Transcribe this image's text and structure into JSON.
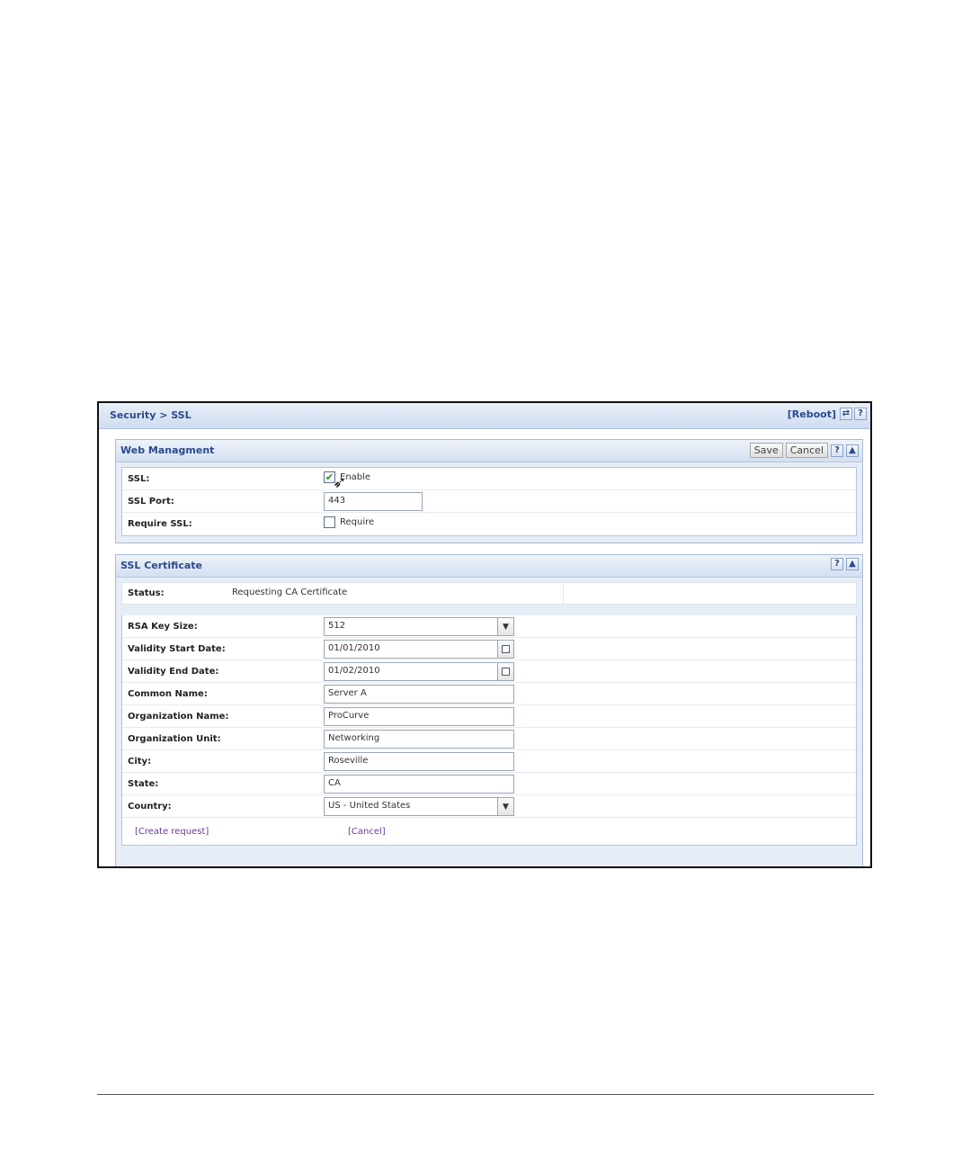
{
  "topbar": {
    "breadcrumb": "Security > SSL",
    "reboot_label": "[Reboot]",
    "refresh_glyph": "⇄",
    "help_glyph": "?"
  },
  "web_management": {
    "title": "Web Managment",
    "save_label": "Save",
    "cancel_label": "Cancel",
    "help_glyph": "?",
    "collapse_glyph": "▲",
    "ssl_label": "SSL:",
    "ssl_enable_checked": true,
    "ssl_enable_label": "Enable",
    "port_label": "SSL Port:",
    "port_value": "443",
    "require_label": "Require SSL:",
    "require_checked": false,
    "require_option_label": "Require"
  },
  "ssl_certificate": {
    "title": "SSL Certificate",
    "help_glyph": "?",
    "collapse_glyph": "▲",
    "status_label": "Status:",
    "status_value": "Requesting CA Certificate",
    "fields": {
      "rsa_label": "RSA Key Size:",
      "rsa_value": "512",
      "start_label": "Validity Start Date:",
      "start_value": "01/01/2010",
      "end_label": "Validity End Date:",
      "end_value": "01/02/2010",
      "cn_label": "Common Name:",
      "cn_value": "Server A",
      "org_label": "Organization Name:",
      "org_value": "ProCurve",
      "unit_label": "Organization Unit:",
      "unit_value": "Networking",
      "city_label": "City:",
      "city_value": "Roseville",
      "state_label": "State:",
      "state_value": "CA",
      "country_label": "Country:",
      "country_value": "US - United States"
    },
    "create_link": "[Create request]",
    "cancel_link": "[Cancel]"
  },
  "icons": {
    "dropdown": "chevron-down-icon",
    "calendar": "calendar-icon",
    "cursor": "mouse-pointer-icon",
    "check": "checkmark-icon"
  }
}
